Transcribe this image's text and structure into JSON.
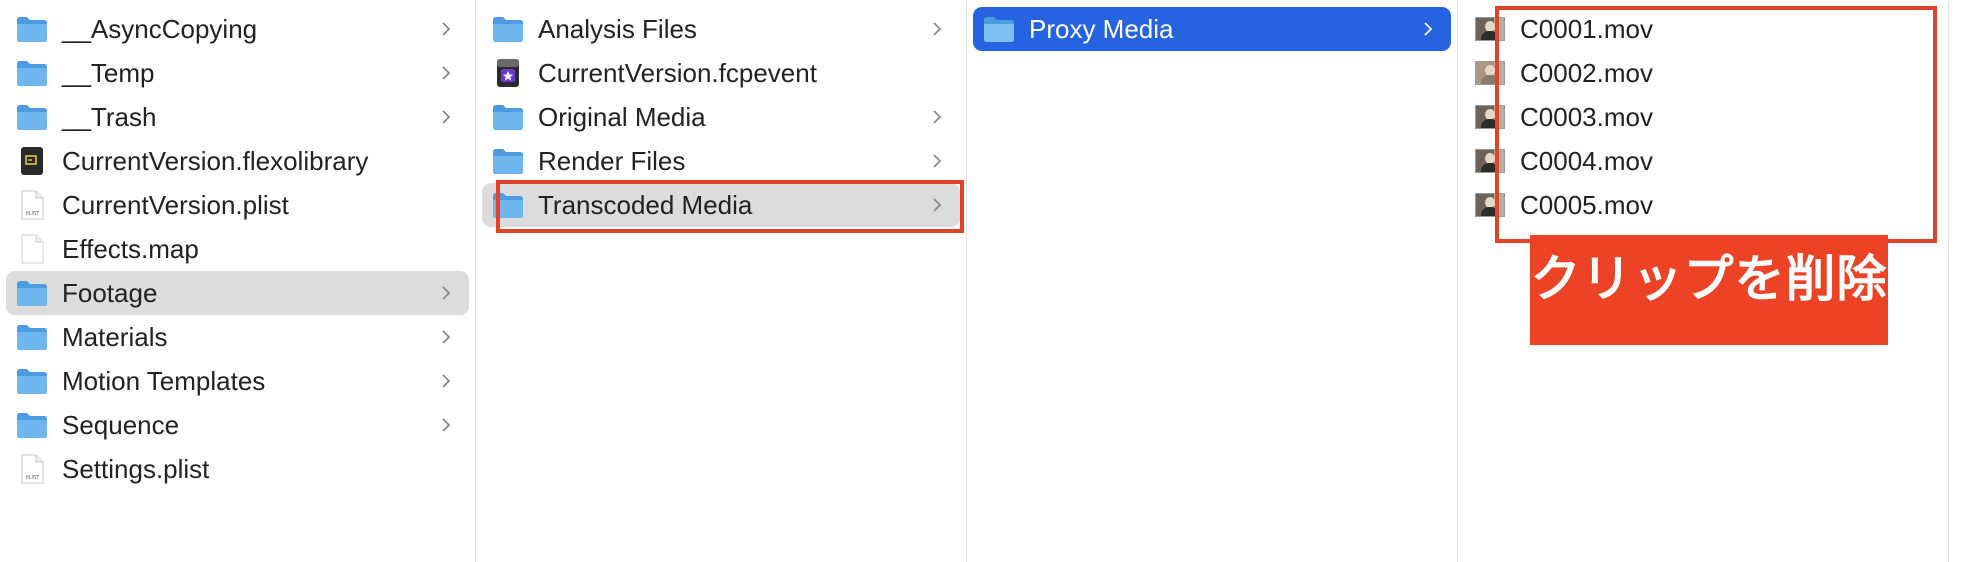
{
  "columns": [
    {
      "items": [
        {
          "label": "__AsyncCopying",
          "icon": "folder-icon",
          "has_children": true
        },
        {
          "label": "__Temp",
          "icon": "folder-icon",
          "has_children": true
        },
        {
          "label": "__Trash",
          "icon": "folder-icon",
          "has_children": true
        },
        {
          "label": "CurrentVersion.flexolibrary",
          "icon": "flexolibrary-file-icon",
          "has_children": false
        },
        {
          "label": "CurrentVersion.plist",
          "icon": "plist-file-icon",
          "has_children": false
        },
        {
          "label": "Effects.map",
          "icon": "blank-file-icon",
          "has_children": false
        },
        {
          "label": "Footage",
          "icon": "folder-icon",
          "has_children": true,
          "selected": "gray"
        },
        {
          "label": "Materials",
          "icon": "folder-icon",
          "has_children": true
        },
        {
          "label": "Motion Templates",
          "icon": "folder-icon",
          "has_children": true
        },
        {
          "label": "Sequence",
          "icon": "folder-icon",
          "has_children": true
        },
        {
          "label": "Settings.plist",
          "icon": "plist-file-icon",
          "has_children": false
        }
      ]
    },
    {
      "items": [
        {
          "label": "Analysis Files",
          "icon": "folder-icon",
          "has_children": true
        },
        {
          "label": "CurrentVersion.fcpevent",
          "icon": "fcpevent-file-icon",
          "has_children": false
        },
        {
          "label": "Original Media",
          "icon": "folder-icon",
          "has_children": true
        },
        {
          "label": "Render Files",
          "icon": "folder-icon",
          "has_children": true
        },
        {
          "label": "Transcoded Media",
          "icon": "folder-icon",
          "has_children": true,
          "selected": "gray",
          "highlighted": true
        }
      ]
    },
    {
      "items": [
        {
          "label": "Proxy Media",
          "icon": "folder-icon",
          "has_children": true,
          "selected": "blue"
        }
      ]
    },
    {
      "items": [
        {
          "label": "C0001.mov",
          "icon": "video-thumbnail-icon",
          "has_children": false
        },
        {
          "label": "C0002.mov",
          "icon": "video-thumbnail-icon",
          "has_children": false
        },
        {
          "label": "C0003.mov",
          "icon": "video-thumbnail-icon",
          "has_children": false
        },
        {
          "label": "C0004.mov",
          "icon": "video-thumbnail-icon",
          "has_children": false
        },
        {
          "label": "C0005.mov",
          "icon": "video-thumbnail-icon",
          "has_children": false
        }
      ]
    }
  ],
  "annotation": {
    "banner_text": "クリップを削除",
    "highlight_color": "#e0432a",
    "banner_color": "#ec4327"
  },
  "colors": {
    "selection_gray": "#dcdcdc",
    "selection_blue": "#2563e0",
    "folder_blue": "#6fb5ee"
  }
}
